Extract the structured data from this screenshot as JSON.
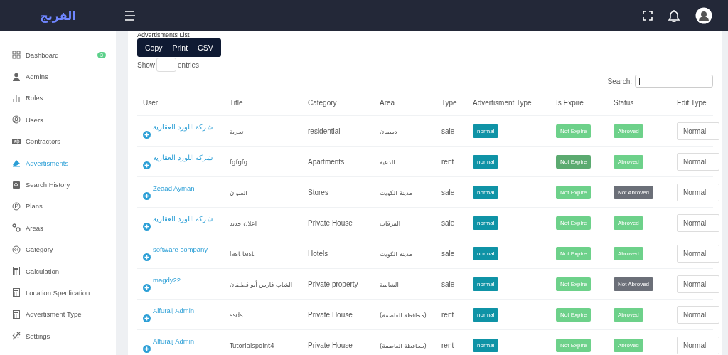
{
  "header": {
    "logo": "الفريج"
  },
  "sidebar": {
    "items": [
      {
        "label": "Dashboard",
        "selected": false,
        "badge": "3"
      },
      {
        "label": "Admins",
        "selected": false
      },
      {
        "label": "Roles",
        "selected": false
      },
      {
        "label": "Users",
        "selected": false
      },
      {
        "label": "Contractors",
        "selected": false
      },
      {
        "label": "Advertisments",
        "selected": true
      },
      {
        "label": "Search History",
        "selected": false
      },
      {
        "label": "Plans",
        "selected": false
      },
      {
        "label": "Areas",
        "selected": false
      },
      {
        "label": "Category",
        "selected": false
      },
      {
        "label": "Calculation",
        "selected": false
      },
      {
        "label": "Location Specfication",
        "selected": false
      },
      {
        "label": "Advertisment Type",
        "selected": false
      },
      {
        "label": "Settings",
        "selected": false
      }
    ]
  },
  "content": {
    "title": "Advertisments List",
    "export_buttons": [
      "Copy",
      "Print",
      "CSV"
    ],
    "show_label": "Show",
    "entries_label": "entries",
    "search_label": "Search:",
    "table": {
      "columns": [
        "User",
        "Title",
        "Category",
        "Area",
        "Type",
        "Advertisment Type",
        "Is Expire",
        "Status",
        "Edit Type"
      ],
      "rows": [
        {
          "user": "شركة اللورد العقارية",
          "title": "تجربة",
          "category": "residential",
          "area": "دسمان",
          "type": "sale",
          "ad_type": "normal",
          "expire": "Not Expire",
          "expire_highlighted": false,
          "status": "Abroved",
          "approved": true,
          "edit_type": "Normal"
        },
        {
          "user": "شركة اللورد العقارية",
          "title": "fgfgfg",
          "category": "Apartments",
          "area": "الدعية",
          "type": "rent",
          "ad_type": "normal",
          "expire": "Not Expire",
          "expire_highlighted": true,
          "status": "Abroved",
          "approved": true,
          "edit_type": "Normal"
        },
        {
          "user": "Zeaad Ayman",
          "title": "العنوان",
          "category": "Stores",
          "area": "مدينة الكويت",
          "type": "sale",
          "ad_type": "normal",
          "expire": "Not Expire",
          "expire_highlighted": false,
          "status": "Not Abroved",
          "approved": false,
          "edit_type": "Normal"
        },
        {
          "user": "شركة اللورد العقارية",
          "title": "اعلان جديد",
          "category": "Private House",
          "area": "المرقاب",
          "type": "sale",
          "ad_type": "normal",
          "expire": "Not Expire",
          "expire_highlighted": false,
          "status": "Abroved",
          "approved": true,
          "edit_type": "Normal"
        },
        {
          "user": "software company",
          "title": "last test",
          "category": "Hotels",
          "area": "مدينة الكويت",
          "type": "sale",
          "ad_type": "normal",
          "expire": "Not Expire",
          "expire_highlighted": false,
          "status": "Abroved",
          "approved": true,
          "edit_type": "Normal"
        },
        {
          "user": "magdy22",
          "title": "الشاب فارس أبو قطيفان",
          "category": "Private property",
          "area": "الشامية",
          "type": "sale",
          "ad_type": "normal",
          "expire": "Not Expire",
          "expire_highlighted": false,
          "status": "Not Abroved",
          "approved": false,
          "edit_type": "Normal"
        },
        {
          "user": "Alfuraij Admin",
          "title": "ssds",
          "category": "Private House",
          "area": "(محافظة العاصمة)",
          "type": "rent",
          "ad_type": "normal",
          "expire": "Not Expire",
          "expire_highlighted": false,
          "status": "Abroved",
          "approved": true,
          "edit_type": "Normal"
        },
        {
          "user": "Alfuraij Admin",
          "title": "Tutorialspoint4",
          "category": "Private House",
          "area": "(محافظة العاصمة)",
          "type": "rent",
          "ad_type": "normal",
          "expire": "Not Expire",
          "expire_highlighted": false,
          "status": "Abroved",
          "approved": true,
          "edit_type": "Normal"
        }
      ]
    }
  }
}
